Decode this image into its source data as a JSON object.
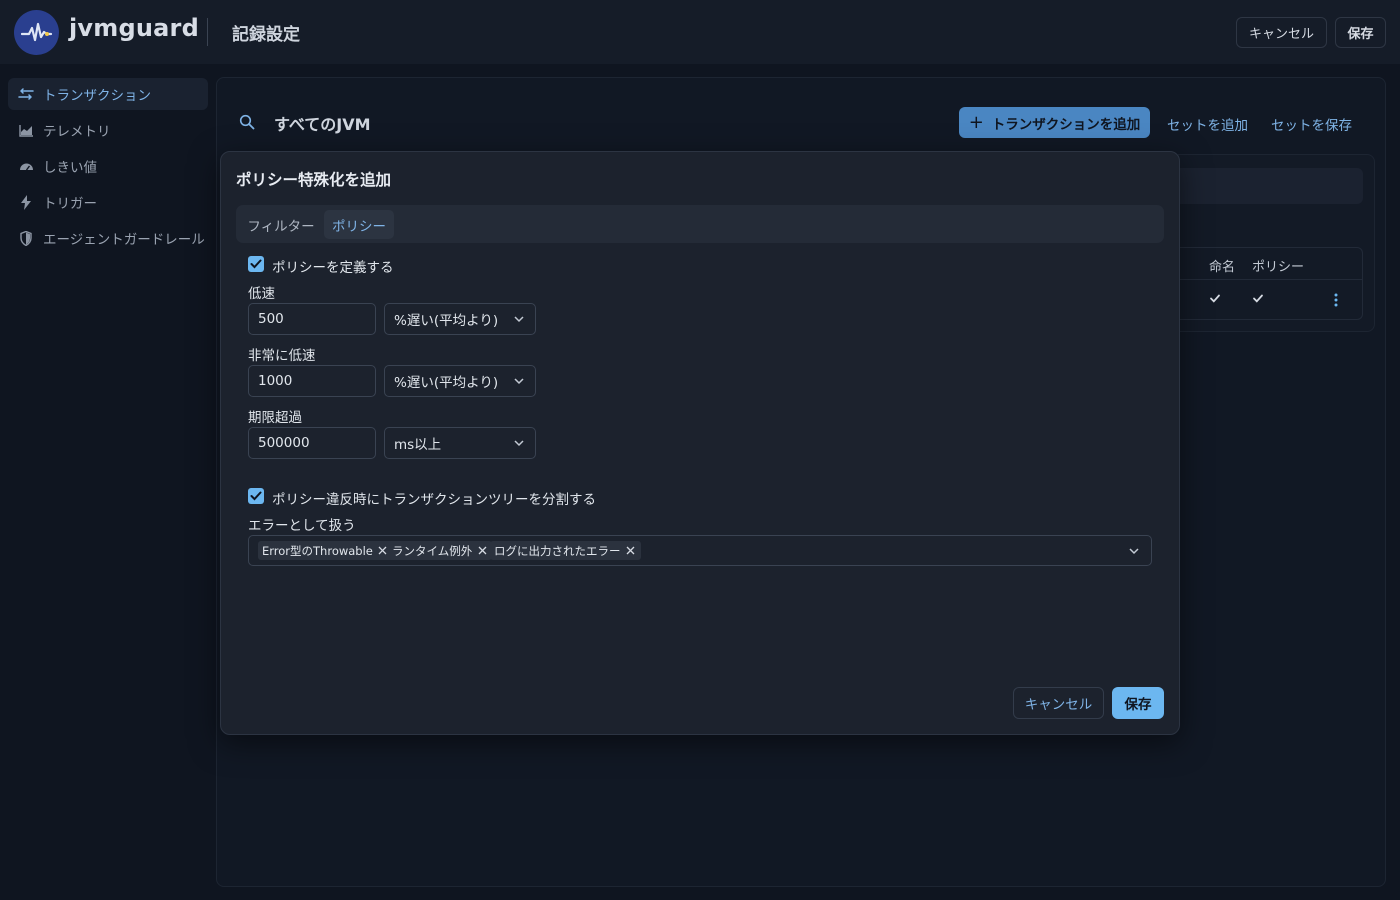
{
  "header": {
    "brand": "jvmguard",
    "title": "記録設定",
    "cancel_label": "キャンセル",
    "save_label": "保存",
    "logo_icon": "pulse-icon"
  },
  "sidebar": {
    "items": [
      {
        "label": "トランザクション",
        "icon": "arrows-icon",
        "active": true
      },
      {
        "label": "テレメトリ",
        "icon": "area-chart-icon",
        "active": false
      },
      {
        "label": "しきい値",
        "icon": "gauge-icon",
        "active": false
      },
      {
        "label": "トリガー",
        "icon": "lightning-icon",
        "active": false
      },
      {
        "label": "エージェントガードレール",
        "icon": "shield-icon",
        "active": false
      }
    ]
  },
  "main": {
    "jvm_title": "すべてのJVM",
    "add_transaction_label": "トランザクションを追加",
    "add_set_label": "セットを追加",
    "save_set_label": "セットを保存",
    "table": {
      "headers": [
        "命名",
        "ポリシー"
      ],
      "rows": [
        {
          "naming": true,
          "policy": true
        }
      ]
    }
  },
  "dialog": {
    "title": "ポリシー特殊化を追加",
    "tabs": [
      {
        "label": "フィルター",
        "active": false
      },
      {
        "label": "ポリシー",
        "active": true
      }
    ],
    "define_policy": {
      "label": "ポリシーを定義する",
      "checked": true
    },
    "slow": {
      "label": "低速",
      "value": "500",
      "unit": "%遅い(平均より)"
    },
    "very_slow": {
      "label": "非常に低速",
      "value": "1000",
      "unit": "%遅い(平均より)"
    },
    "overdue": {
      "label": "期限超過",
      "value": "500000",
      "unit": "ms以上"
    },
    "split_tree": {
      "label": "ポリシー違反時にトランザクションツリーを分割する",
      "checked": true
    },
    "treat_as_error": {
      "label": "エラーとして扱う",
      "chips": [
        "Error型のThrowable",
        "ランタイム例外",
        "ログに出力されたエラー"
      ]
    },
    "cancel_label": "キャンセル",
    "save_label": "保存"
  },
  "colors": {
    "accent": "#6cb7f0",
    "link": "#7fb3e6",
    "background": "#0f1520",
    "dialog": "#1c222d"
  }
}
